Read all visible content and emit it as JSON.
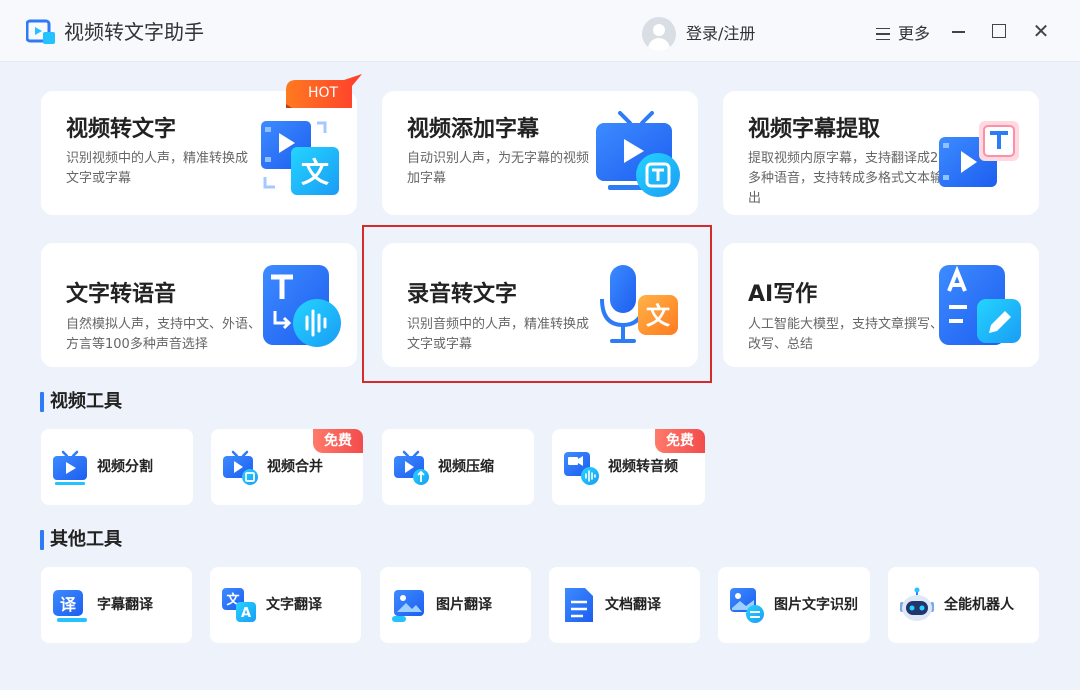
{
  "app": {
    "title": "视频转文字助手"
  },
  "header": {
    "login_label": "登录/注册",
    "more_label": "更多"
  },
  "feature_cards": [
    {
      "title": "视频转文字",
      "desc": "识别视频中的人声，精准转换成文字或字幕",
      "badge": "HOT"
    },
    {
      "title": "视频添加字幕",
      "desc": "自动识别人声，为无字幕的视频加字幕"
    },
    {
      "title": "视频字幕提取",
      "desc": "提取视频内原字幕，支持翻译成20多种语音，支持转成多格式文本输出"
    },
    {
      "title": "文字转语音",
      "desc": "自然模拟人声，支持中文、外语、方言等100多种声音选择"
    },
    {
      "title": "录音转文字",
      "desc": "识别音频中的人声，精准转换成文字或字幕",
      "highlighted": true
    },
    {
      "title": "AI写作",
      "desc": "人工智能大模型，支持文章撰写、改写、总结"
    }
  ],
  "video_tools": {
    "heading": "视频工具",
    "items": [
      {
        "label": "视频分割",
        "badge": ""
      },
      {
        "label": "视频合并",
        "badge": "免费"
      },
      {
        "label": "视频压缩",
        "badge": ""
      },
      {
        "label": "视频转音频",
        "badge": "免费"
      }
    ]
  },
  "other_tools": {
    "heading": "其他工具",
    "items": [
      {
        "label": "字幕翻译"
      },
      {
        "label": "文字翻译"
      },
      {
        "label": "图片翻译"
      },
      {
        "label": "文档翻译"
      },
      {
        "label": "图片文字识别"
      },
      {
        "label": "全能机器人"
      }
    ]
  },
  "colors": {
    "accent": "#2d7cf6",
    "highlight_border": "#d62b2b",
    "hot_badge": "#ff5a1f",
    "free_badge": "#f24c4c",
    "background": "#edf2fb"
  }
}
